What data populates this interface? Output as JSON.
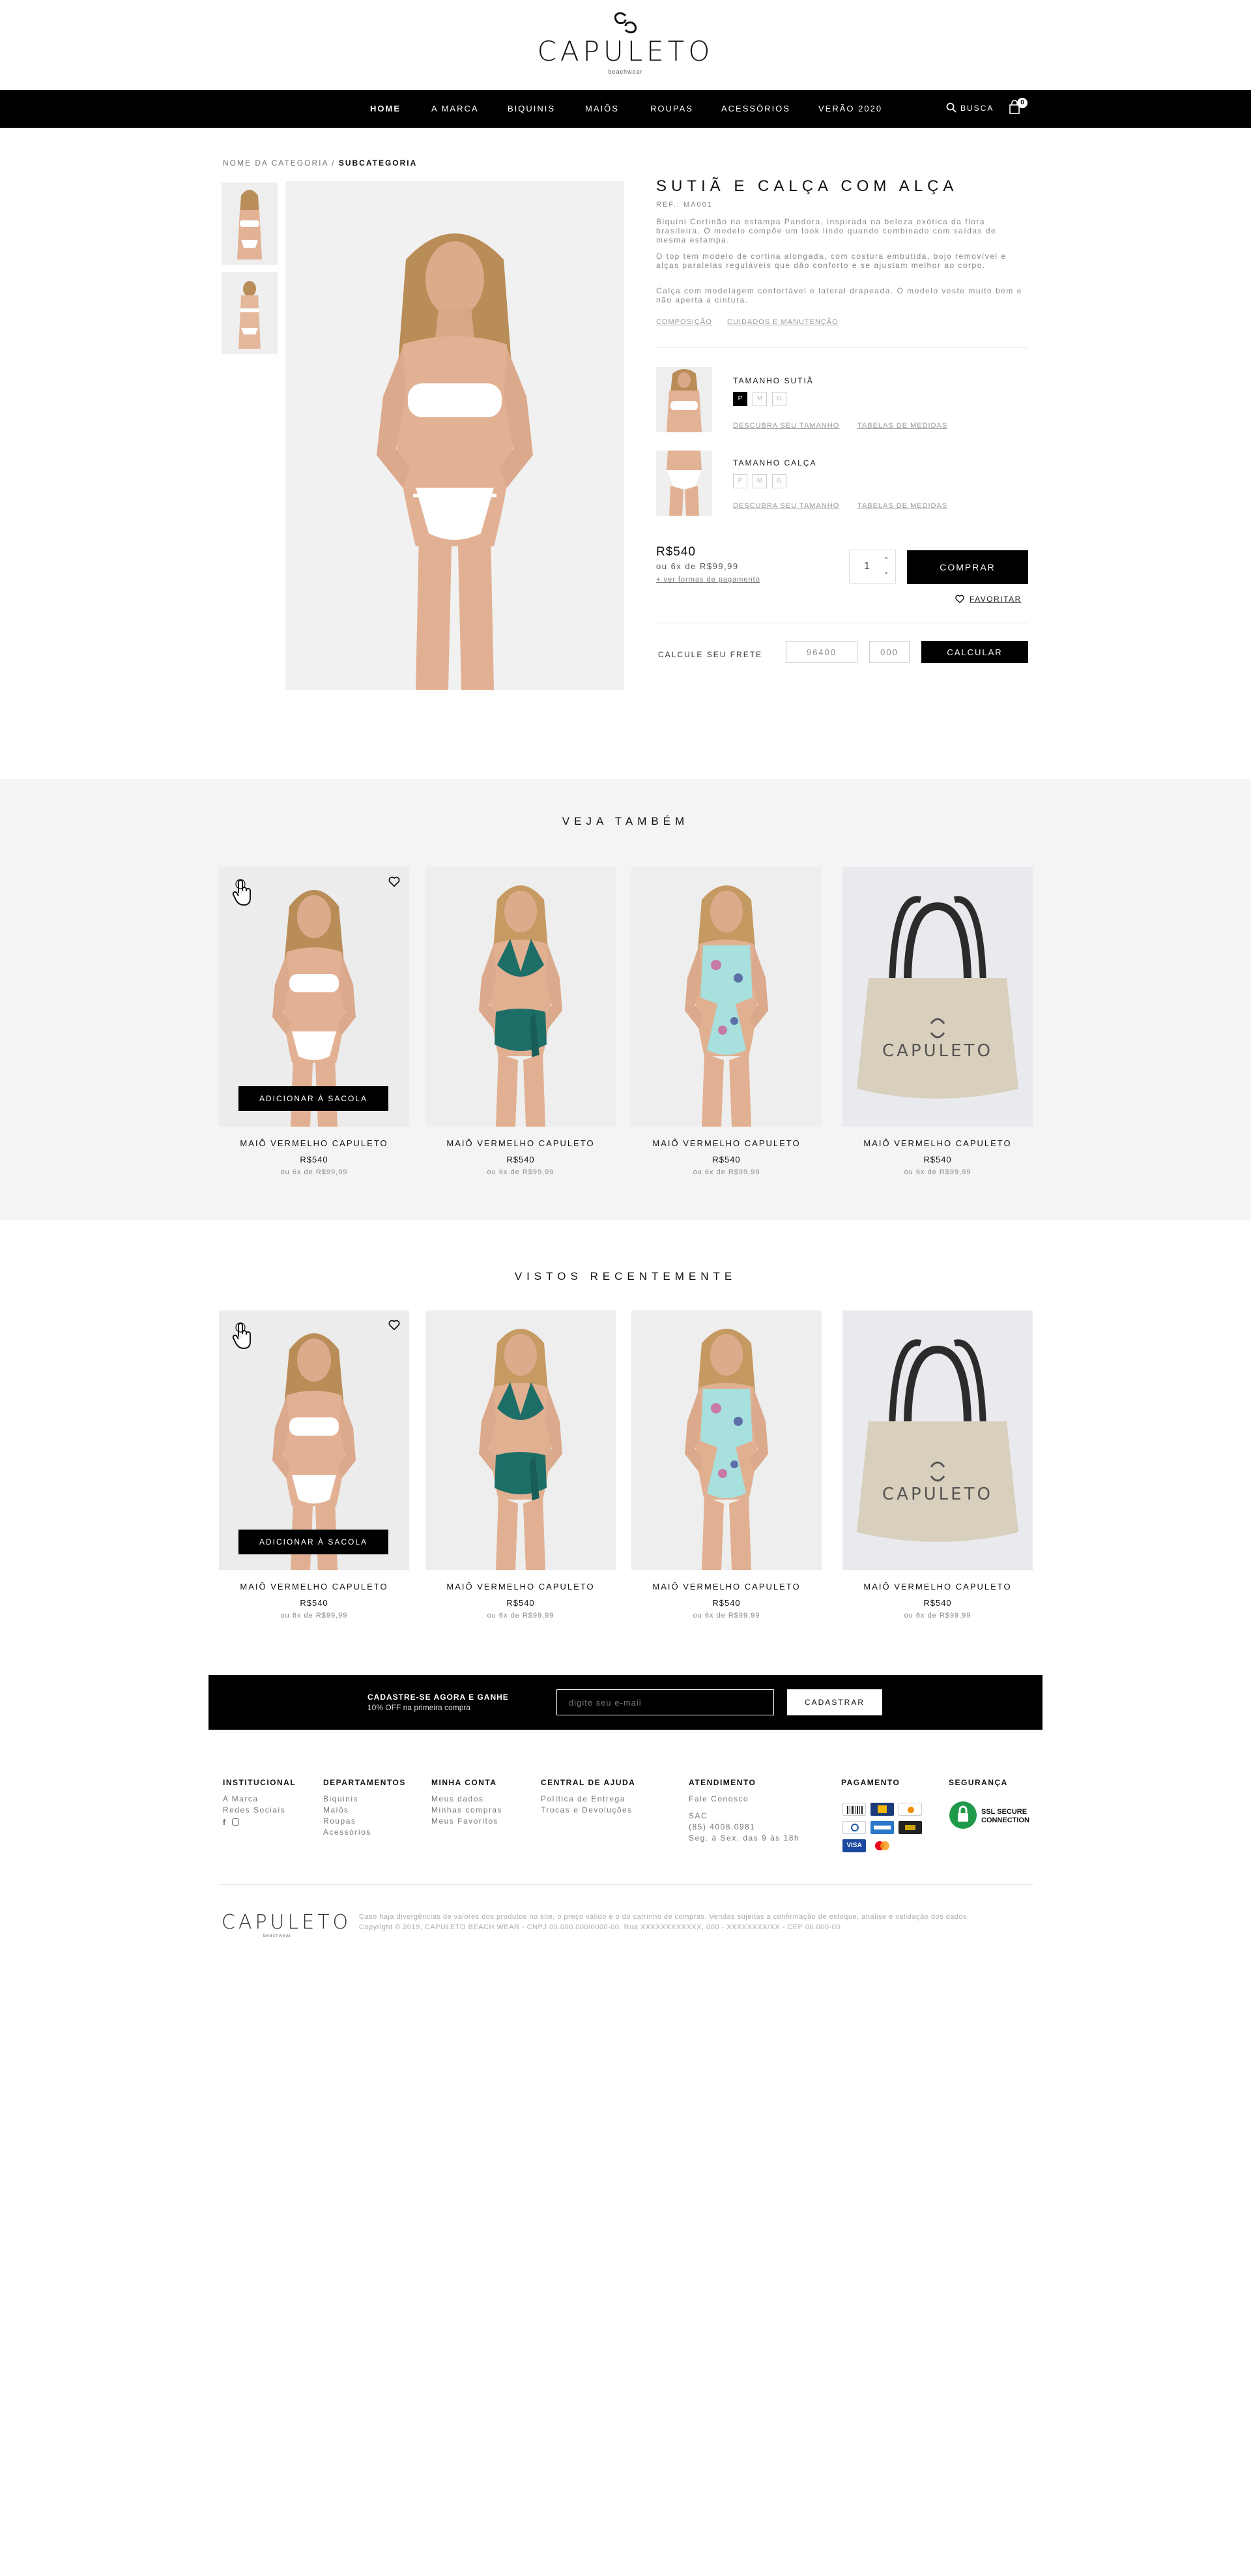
{
  "brand": {
    "name": "CAPULETO",
    "tagline": "beachwear"
  },
  "nav": {
    "items": [
      {
        "label": "HOME",
        "active": true
      },
      {
        "label": "A MARCA"
      },
      {
        "label": "BIQUINIS"
      },
      {
        "label": "MAIÔS"
      },
      {
        "label": "ROUPAS"
      },
      {
        "label": "ACESSÓRIOS"
      },
      {
        "label": "VERÃO 2020"
      }
    ],
    "search_label": "BUSCA",
    "cart_count": "0"
  },
  "breadcrumb": {
    "category": "NOME DA CATEGORIA",
    "separator": "/",
    "subcategory": "SUBCATEGORIA"
  },
  "product": {
    "title": "SUTIÃ E CALÇA COM ALÇA",
    "ref": "REF.: MA001",
    "description": [
      "Biquíni Cortinão na estampa Pandora, inspirada na beleza exótica da flora brasileira. O modelo compõe um look lindo quando combinado com saídas de mesma estampa.",
      "O top tem modelo de cortina alongada, com costura embutida, bojo removível e alças paralelas reguláveis que dão conforto e se ajustam melhor ao corpo.",
      "Calça com modelagem confortável e lateral drapeada. O modelo veste muito bem e não aperta a cintura."
    ],
    "links": {
      "composition": "COMPOSIÇÃO",
      "care": "CUIDADOS E MANUTENÇÃO"
    },
    "top_size": {
      "label": "TAMANHO SUTIÃ",
      "options": [
        "P",
        "M",
        "G"
      ],
      "selected": "P"
    },
    "bottom_size": {
      "label": "TAMANHO CALÇA",
      "options": [
        "P",
        "M",
        "G"
      ],
      "selected": null
    },
    "size_links": {
      "discover": "DESCUBRA SEU TAMANHO",
      "tables": "TABELAS DE MEDIDAS"
    },
    "price": "R$540",
    "installments": "ou 6x de R$99,99",
    "payment_link": "+ ver formas de pagamento",
    "quantity": "1",
    "buy_label": "COMPRAR",
    "favorite_label": "FAVORITAR",
    "freight": {
      "label": "CALCULE SEU FRETE",
      "cep1": "96400",
      "cep2": "000",
      "button": "CALCULAR"
    }
  },
  "see_also": {
    "title": "VEJA TAMBÉM",
    "add_label": "ADICIONAR À SACOLA",
    "products": [
      {
        "name": "MAIÔ VERMELHO CAPULETO",
        "price": "R$540",
        "installments": "ou 6x de R$99,99",
        "image": "white-bikini"
      },
      {
        "name": "MAIÔ VERMELHO CAPULETO",
        "price": "R$540",
        "installments": "ou 6x de R$99,99",
        "image": "green-bikini"
      },
      {
        "name": "MAIÔ VERMELHO CAPULETO",
        "price": "R$540",
        "installments": "ou 6x de R$99,99",
        "image": "floral-swimsuit"
      },
      {
        "name": "MAIÔ VERMELHO CAPULETO",
        "price": "R$540",
        "installments": "ou 6x de R$99,99",
        "image": "canvas-bag"
      }
    ]
  },
  "recently_viewed": {
    "title": "VISTOS RECENTEMENTE",
    "add_label": "ADICIONAR À SACOLA",
    "products": [
      {
        "name": "MAIÔ VERMELHO CAPULETO",
        "price": "R$540",
        "installments": "ou 6x de R$99,99",
        "image": "white-bikini"
      },
      {
        "name": "MAIÔ VERMELHO CAPULETO",
        "price": "R$540",
        "installments": "ou 6x de R$99,99",
        "image": "green-bikini"
      },
      {
        "name": "MAIÔ VERMELHO CAPULETO",
        "price": "R$540",
        "installments": "ou 6x de R$99,99",
        "image": "floral-swimsuit"
      },
      {
        "name": "MAIÔ VERMELHO CAPULETO",
        "price": "R$540",
        "installments": "ou 6x de R$99,99",
        "image": "canvas-bag"
      }
    ]
  },
  "newsletter": {
    "headline": "CADASTRE-SE AGORA E GANHE",
    "subline": "10% OFF na primeira compra",
    "placeholder": "digite seu e-mail",
    "button": "CADASTRAR"
  },
  "footer": {
    "institutional": {
      "title": "INSTITUCIONAL",
      "links": [
        "A Marca",
        "Redes Sociais"
      ]
    },
    "departments": {
      "title": "DEPARTAMENTOS",
      "links": [
        "Biquinis",
        "Maiôs",
        "Roupas",
        "Acessórios"
      ]
    },
    "account": {
      "title": "MINHA CONTA",
      "links": [
        "Meus dados",
        "Minhas compras",
        "Meus Favoritos"
      ]
    },
    "help": {
      "title": "CENTRAL DE AJUDA",
      "links": [
        "Política de Entrega",
        "Trocas e Devoluções"
      ]
    },
    "service": {
      "title": "ATENDIMENTO",
      "links": [
        "Fale Conosco",
        "SAC",
        "(85) 4008.0981",
        "Seg. à Sex. das 9 às 18h"
      ]
    },
    "payment": {
      "title": "PAGAMENTO"
    },
    "security": {
      "title": "SEGURANÇA",
      "badge_line1": "SSL SECURE",
      "badge_line2": "CONNECTION"
    },
    "legal_line1": "Caso haja divergências de valores dos produtos no site, o preço válido é o do carrinho de compras. Vendas sujeitas a confirmação de estoque, análise e validação dos dados.",
    "legal_line2": "Copyright © 2019, CAPULETO BEACH WEAR - CNPJ 00.000.000/0000-00. Rua XXXXXXXXXXXX, 000 - XXXXXXXX/XX - CEP 00.000-00"
  },
  "colors": {
    "black": "#000000",
    "accent_gray": "#f4f4f4",
    "teal": "#1e6e68",
    "mint": "#a7e0dc"
  }
}
